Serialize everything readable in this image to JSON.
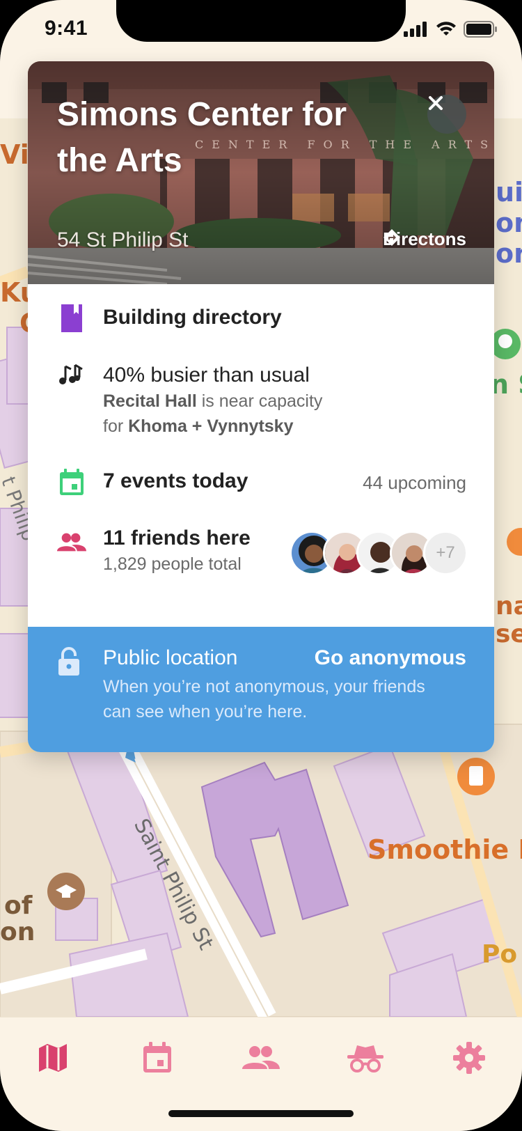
{
  "status": {
    "time": "9:41"
  },
  "place": {
    "title": "Simons Center for the Arts",
    "address": "54 St Philip St",
    "directions_label": "Directons",
    "building_facade_text": "CENTER FOR THE ARTS"
  },
  "rows": {
    "directory": {
      "label": "Building directory",
      "icon": "book-icon",
      "icon_color": "#8b3fd1"
    },
    "busy": {
      "label": "40% busier than usual",
      "icon": "music-notes-icon",
      "line1_bold": "Recital Hall",
      "line1_rest": " is near capacity",
      "line2_pre": "for ",
      "line2_bold": "Khoma + Vynnytsky"
    },
    "events": {
      "label": "7 events today",
      "meta": "44 upcoming",
      "icon": "calendar-icon",
      "icon_color": "#3ed07a"
    },
    "friends": {
      "label": "11 friends here",
      "sub": "1,829 people total",
      "icon": "people-icon",
      "icon_color": "#d9416e",
      "more_count": "+7"
    }
  },
  "privacy": {
    "title": "Public location",
    "action": "Go anonymous",
    "description": "When you’re not anonymous, your friends can see when you’re here.",
    "background": "#4f9ee0"
  },
  "map_labels": {
    "street": "Saint Philip St",
    "smoothie": "Smoothie I",
    "philip_left": "t Philip",
    "of": "of",
    "on": "on",
    "vi": "Vi",
    "ku": "Ku",
    "c": "C",
    "ui": "ui",
    "on_right": "on",
    "or": "or",
    "s_green": "n S",
    "na": "na",
    "se": "se",
    "po": "Po",
    "st": "St"
  },
  "tabs": [
    {
      "name": "map",
      "icon": "map-icon",
      "active": true
    },
    {
      "name": "calendar",
      "icon": "calendar-icon"
    },
    {
      "name": "friends",
      "icon": "people-icon"
    },
    {
      "name": "anonymous",
      "icon": "incognito-icon"
    },
    {
      "name": "settings",
      "icon": "gear-icon"
    }
  ],
  "colors": {
    "accent": "#d9416e",
    "tab_inactive": "#ec7f9d",
    "background": "#fbf3e6"
  }
}
